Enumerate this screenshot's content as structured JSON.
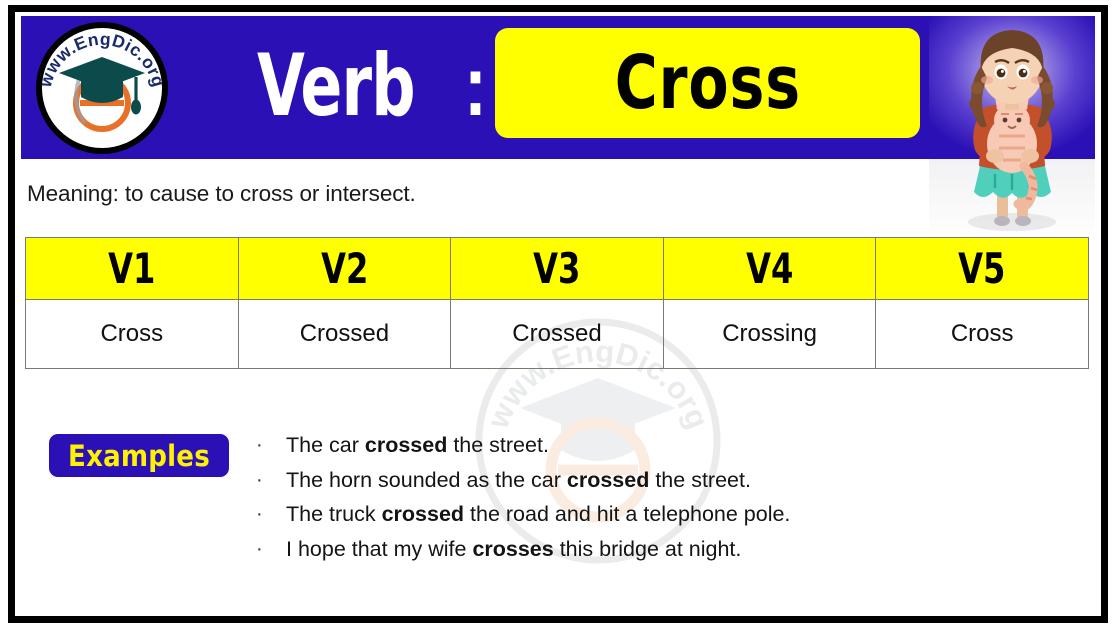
{
  "branding": {
    "logo_text": "www.EngDic.org",
    "logo_name": "engdic-logo",
    "watermark_text": "www.EngDic.org"
  },
  "header": {
    "part_of_speech_label": "Verb",
    "separator": ":",
    "word": "Cross",
    "illustration_name": "girl-holding-cat-illustration",
    "background_color": "#2B10B5",
    "chip_color": "#FFFF00",
    "chip_text_color": "#000000",
    "label_text_color": "#FFFFFF"
  },
  "meaning": {
    "text": "Meaning: to cause to cross or intersect."
  },
  "table": {
    "headers": [
      "V1",
      "V2",
      "V3",
      "V4",
      "V5"
    ],
    "rows": [
      [
        "Cross",
        "Crossed",
        "Crossed",
        "Crossing",
        "Cross"
      ]
    ],
    "header_background": "#FFFF00",
    "header_text_color": "#000000",
    "border_color": "#7A7A6E"
  },
  "examples": {
    "badge_label": "Examples",
    "badge_background": "#2B10B5",
    "badge_text_color": "#FFF200",
    "bullet_glyph": "·",
    "items": [
      {
        "before": "The car ",
        "bold": "crossed",
        "after": " the street."
      },
      {
        "before": "The horn sounded as the car ",
        "bold": "crossed",
        "after": " the street."
      },
      {
        "before": "The truck ",
        "bold": "crossed",
        "after": " the road and hit a telephone pole."
      },
      {
        "before": "I hope that my wife ",
        "bold": "crosses",
        "after": " this bridge at night."
      }
    ]
  }
}
